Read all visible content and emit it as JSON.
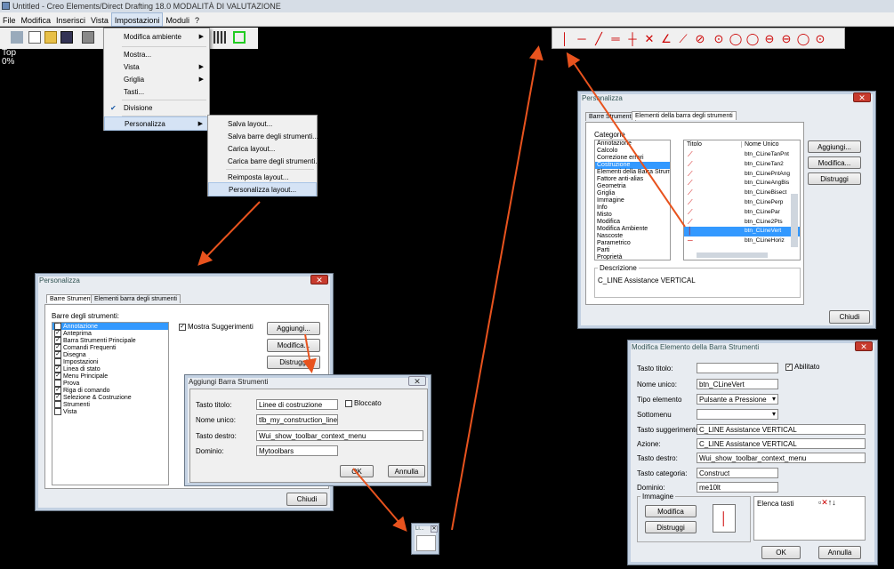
{
  "titlebar": {
    "title": "Untitled - Creo Elements/Direct Drafting 18.0 MODALITÀ DI VALUTAZIONE"
  },
  "menubar": [
    "File",
    "Modifica",
    "Inserisci",
    "Vista",
    "Impostazioni",
    "Moduli",
    "?"
  ],
  "viewport": {
    "view": "Top",
    "zoom": "0%"
  },
  "impostazioni_menu": {
    "items": [
      "Modifica ambiente",
      "Mostra...",
      "Vista",
      "Griglia",
      "Tasti...",
      "Divisione",
      "Personalizza"
    ]
  },
  "personalizza_submenu": {
    "items": [
      "Salva layout...",
      "Salva barre degli strumenti...",
      "Carica layout...",
      "Carica barre degli strumenti...",
      "Reimposta layout...",
      "Personalizza layout..."
    ]
  },
  "dlg1": {
    "title": "Personalizza",
    "tabs": [
      "Barre Strumenti",
      "Elementi barra degli strumenti"
    ],
    "list_label": "Barre degli strumenti:",
    "toolbars": [
      {
        "label": "Annotazione",
        "checked": true
      },
      {
        "label": "Anteprima",
        "checked": true
      },
      {
        "label": "Barra Strumenti Principale",
        "checked": true
      },
      {
        "label": "Comandi Frequenti",
        "checked": true
      },
      {
        "label": "Disegna",
        "checked": true
      },
      {
        "label": "Impostazioni",
        "checked": false
      },
      {
        "label": "Linea di stato",
        "checked": true
      },
      {
        "label": "Menu Principale",
        "checked": true
      },
      {
        "label": "Prova",
        "checked": false
      },
      {
        "label": "Riga di comando",
        "checked": true
      },
      {
        "label": "Selezione & Costruzione",
        "checked": true
      },
      {
        "label": "Strumenti",
        "checked": false
      },
      {
        "label": "Vista",
        "checked": false
      }
    ],
    "show_tips": "Mostra Suggerimenti",
    "add": "Aggiungi...",
    "edit": "Modifica...",
    "delete": "Distruggi",
    "close": "Chiudi"
  },
  "dlg2": {
    "title": "Aggiungi Barra Strumenti",
    "title_label": "Tasto titolo:",
    "title_value": "Linee di costruzione",
    "locked": "Bloccato",
    "id_label": "Nome unico:",
    "id_value": "tlb_my_construction_lines",
    "right_label": "Tasto destro:",
    "right_value": "Wui_show_toolbar_context_menu",
    "domain_label": "Dominio:",
    "domain_value": "Mytoolbars",
    "ok": "OK",
    "cancel": "Annulla"
  },
  "dlg3": {
    "title": "Personalizza",
    "tabs": [
      "Barre Strumenti",
      "Elementi della barra degli strumenti"
    ],
    "cat_label": "Categorie",
    "categories": [
      "Annotazione",
      "Calcolo",
      "Correzione errori",
      "Costruzione",
      "Elementi della Barra Strume",
      "Fattore anti-alias",
      "Geometria",
      "Griglia",
      "Immagine",
      "Info",
      "Misto",
      "Modifica",
      "Modifica Ambiente",
      "Nascoste",
      "Parametrico",
      "Parti",
      "Proprietà"
    ],
    "col_title": "Titolo",
    "col_name": "Nome Unico",
    "items": [
      "btn_CLineTanPnt",
      "btn_CLineTan2",
      "btn_CLinePntAng",
      "btn_CLineAngBis",
      "btn_CLineBisect",
      "btn_CLinePerp",
      "btn_CLinePar",
      "btn_CLine2Pts",
      "btn_CLineVert",
      "btn_CLineHoriz"
    ],
    "desc_label": "Descrizione",
    "desc_value": "C_LINE Assistance VERTICAL",
    "add": "Aggiungi...",
    "edit": "Modifica...",
    "delete": "Distruggi",
    "close": "Chiudi"
  },
  "dlg4": {
    "title": "Modifica Elemento della Barra Strumenti",
    "fields": [
      {
        "label": "Tasto titolo:",
        "value": ""
      },
      {
        "label": "Nome unico:",
        "value": "btn_CLineVert"
      },
      {
        "label": "Tipo elemento",
        "value": "Pulsante a Pressione"
      },
      {
        "label": "Sottomenu",
        "value": ""
      },
      {
        "label": "Tasto suggerimento:",
        "value": "C_LINE Assistance VERTICAL"
      },
      {
        "label": "Azione:",
        "value": "C_LINE Assistance VERTICAL"
      },
      {
        "label": "Tasto destro:",
        "value": "Wui_show_toolbar_context_menu"
      },
      {
        "label": "Tasto categoria:",
        "value": "Construct"
      },
      {
        "label": "Dominio:",
        "value": "me10lt"
      }
    ],
    "enabled": "Abilitato",
    "image": "Immagine",
    "img_edit": "Modifica",
    "img_delete": "Distruggi",
    "keys": "Elenca tasti",
    "ok": "OK",
    "cancel": "Annulla"
  },
  "miniwin": {
    "title": "Li..."
  },
  "colors": {
    "arrow": "#e8531e",
    "icon_red": "#cc0000",
    "selection": "#3399ff"
  }
}
